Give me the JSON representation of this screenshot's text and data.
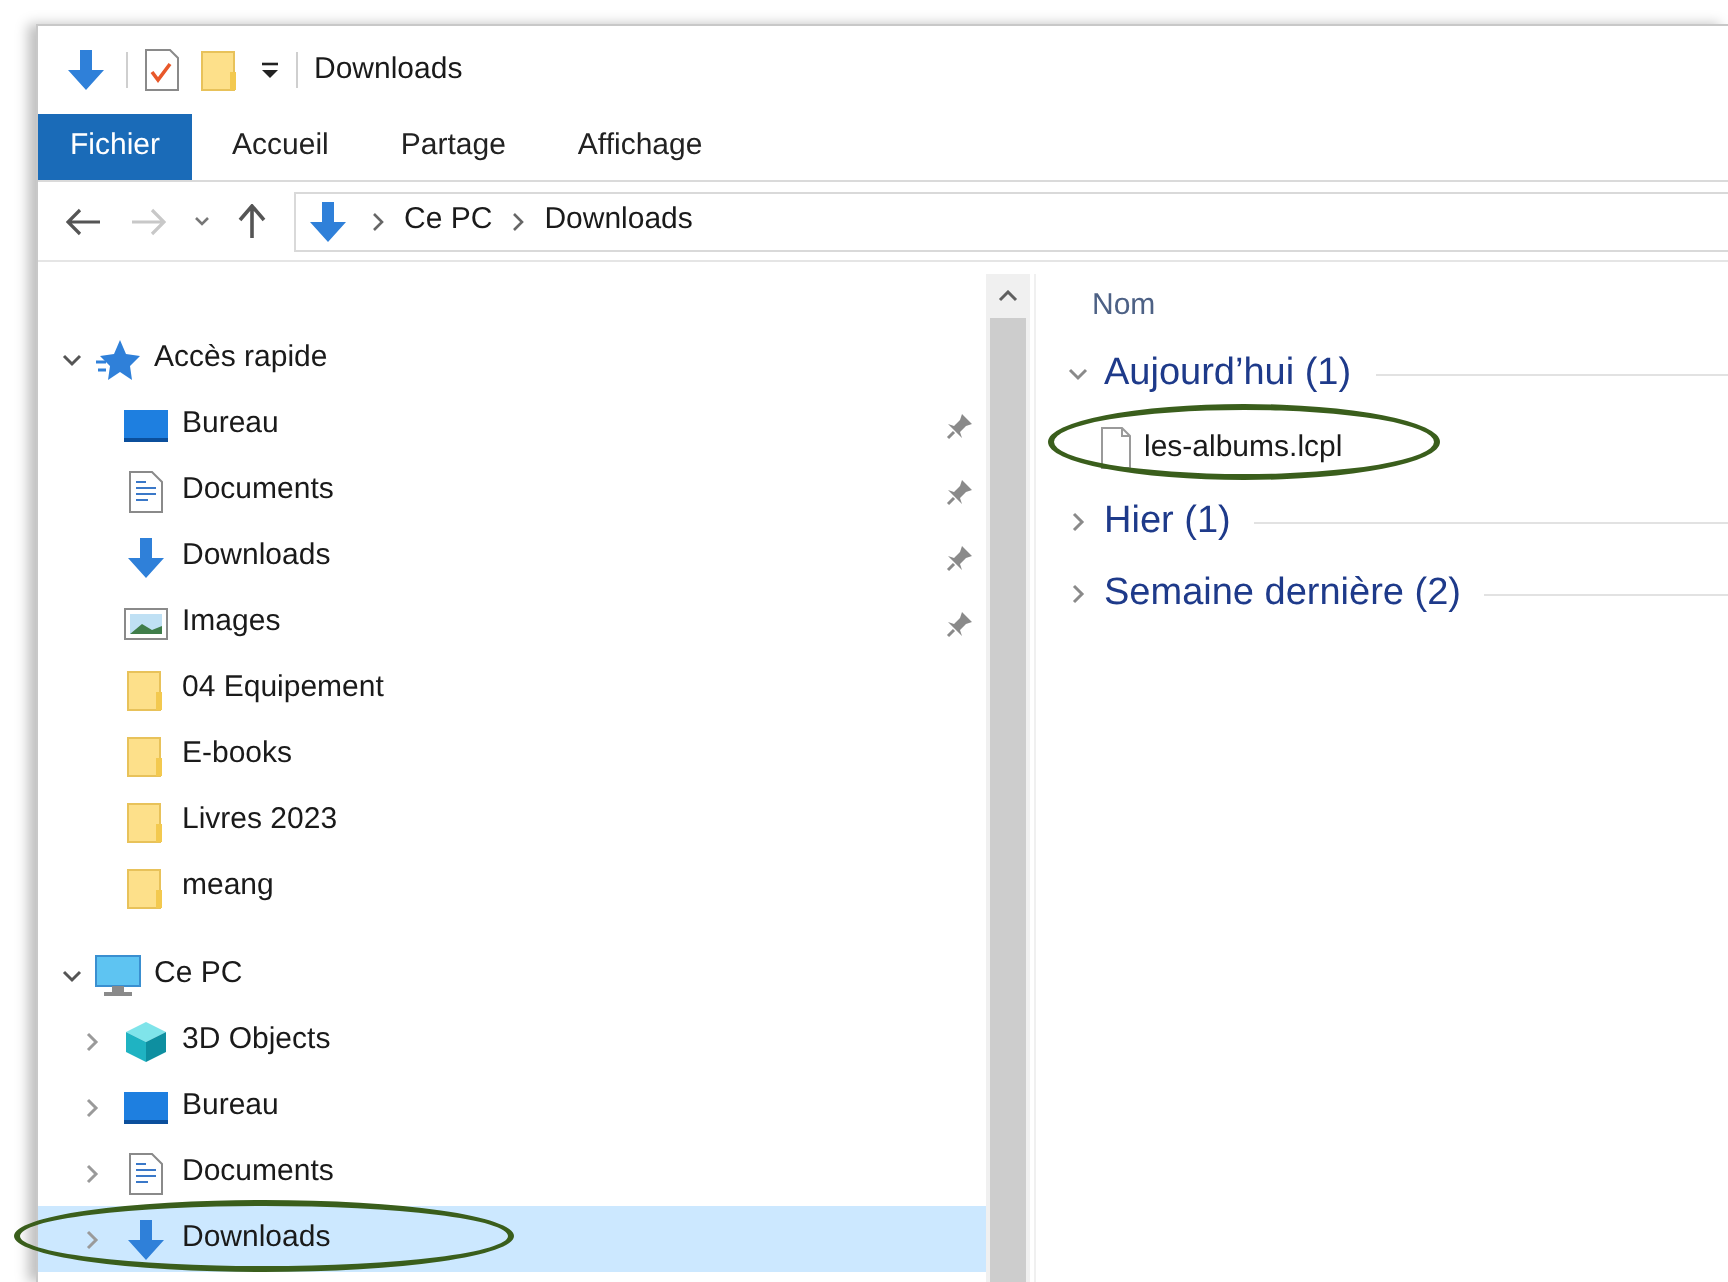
{
  "window": {
    "title": "Downloads"
  },
  "ribbon_tabs": [
    {
      "label": "Fichier",
      "selected": true
    },
    {
      "label": "Accueil",
      "selected": false
    },
    {
      "label": "Partage",
      "selected": false
    },
    {
      "label": "Affichage",
      "selected": false
    }
  ],
  "address_bar": {
    "path": [
      "Ce PC",
      "Downloads"
    ]
  },
  "navigation": [
    {
      "label": "Accès rapide",
      "kind": "quick_access",
      "expanded": true,
      "selected": false,
      "children": [
        {
          "label": "Bureau",
          "kind": "desktop",
          "pinned": true,
          "selected": false
        },
        {
          "label": "Documents",
          "kind": "documents",
          "pinned": true,
          "selected": false
        },
        {
          "label": "Downloads",
          "kind": "downloads",
          "pinned": true,
          "selected": false
        },
        {
          "label": "Images",
          "kind": "images",
          "pinned": true,
          "selected": false
        },
        {
          "label": "04 Equipement",
          "kind": "folder",
          "pinned": false,
          "selected": false
        },
        {
          "label": "E-books",
          "kind": "folder",
          "pinned": false,
          "selected": false
        },
        {
          "label": "Livres 2023",
          "kind": "folder",
          "pinned": false,
          "selected": false
        },
        {
          "label": "meang",
          "kind": "folder",
          "pinned": false,
          "selected": false
        }
      ]
    },
    {
      "label": "Ce PC",
      "kind": "pc",
      "expanded": true,
      "selected": false,
      "children": [
        {
          "label": "3D Objects",
          "kind": "objects3d",
          "expanded": false,
          "selected": false,
          "circled": false
        },
        {
          "label": "Bureau",
          "kind": "desktop",
          "expanded": false,
          "selected": false,
          "circled": false
        },
        {
          "label": "Documents",
          "kind": "documents",
          "expanded": false,
          "selected": false,
          "circled": false
        },
        {
          "label": "Downloads",
          "kind": "downloads",
          "expanded": false,
          "selected": true,
          "circled": true
        }
      ]
    }
  ],
  "file_list": {
    "column": "Nom",
    "groups": [
      {
        "label": "Aujourd’hui (1)",
        "expanded": true,
        "files": [
          {
            "name": "les-albums.lcpl",
            "circled": true
          }
        ]
      },
      {
        "label": "Hier (1)",
        "expanded": false
      },
      {
        "label": "Semaine dernière (2)",
        "expanded": false
      }
    ]
  }
}
